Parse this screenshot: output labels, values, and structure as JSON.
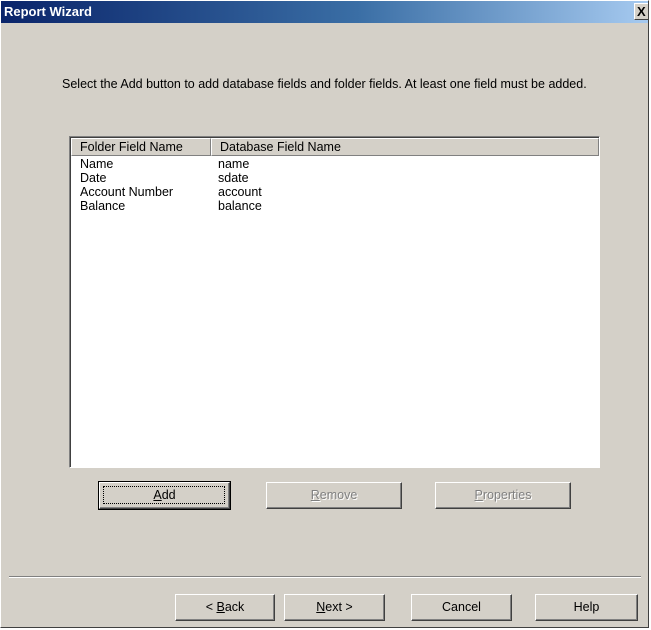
{
  "window": {
    "title": "Report Wizard",
    "close_glyph": "X"
  },
  "instructions": "Select the Add button to add database fields and folder fields.  At least one field must be added.",
  "field_list": {
    "columns": [
      "Folder Field Name",
      "Database Field Name"
    ],
    "rows": [
      {
        "folder_field": "Name",
        "database_field": "name"
      },
      {
        "folder_field": "Date",
        "database_field": "sdate"
      },
      {
        "folder_field": "Account Number",
        "database_field": "account"
      },
      {
        "folder_field": "Balance",
        "database_field": "balance"
      }
    ]
  },
  "list_buttons": {
    "add": {
      "mnemonic": "A",
      "rest": "dd",
      "enabled": true
    },
    "remove": {
      "mnemonic": "R",
      "rest": "emove",
      "enabled": false
    },
    "properties": {
      "mnemonic": "P",
      "rest": "roperties",
      "enabled": false
    }
  },
  "nav_buttons": {
    "back": {
      "prefix": "< ",
      "mnemonic": "B",
      "rest": "ack"
    },
    "next": {
      "mnemonic": "N",
      "rest": "ext >"
    },
    "cancel": {
      "label": "Cancel"
    },
    "help": {
      "label": "Help"
    }
  },
  "colors": {
    "titlebar_start": "#0a246a",
    "titlebar_end": "#a6caf0",
    "dialog_face": "#d4d0c8"
  }
}
